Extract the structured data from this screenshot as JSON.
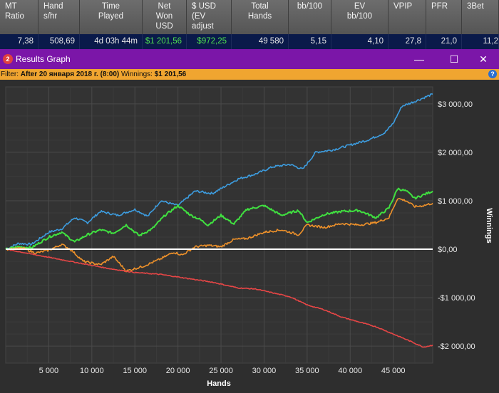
{
  "stats": {
    "headers": [
      [
        "MT",
        "Ratio"
      ],
      [
        "Hand",
        "s/hr"
      ],
      [
        "Time",
        "Played"
      ],
      [
        "Net",
        "Won",
        "USD"
      ],
      [
        "$ USD",
        "(EV",
        "adjust"
      ],
      [
        "Total",
        "Hands"
      ],
      [
        "bb/100"
      ],
      [
        "EV",
        "bb/100"
      ],
      [
        "VPIP"
      ],
      [
        "PFR"
      ],
      [
        "3Bet"
      ]
    ],
    "values": [
      "7,38",
      "508,69",
      "4d 03h 44m",
      "$1 201,56",
      "$972,25",
      "49 580",
      "5,15",
      "4,10",
      "27,8",
      "21,0",
      "11,2"
    ]
  },
  "window": {
    "icon_label": "2",
    "title": "Results Graph",
    "minimize": "—",
    "maximize": "☐",
    "close": "✕"
  },
  "filter": {
    "prefix": "Filter: ",
    "date": "After 20 января 2018 г. (8:00)",
    "winnings_label": " Winnings: ",
    "winnings_value": "$1 201,56",
    "help": "?"
  },
  "chart_data": {
    "type": "line",
    "title": "",
    "xlabel": "Hands",
    "ylabel": "Winnings",
    "xlim": [
      0,
      49580
    ],
    "ylim": [
      -2350,
      3350
    ],
    "x_ticks": [
      5000,
      10000,
      15000,
      20000,
      25000,
      30000,
      35000,
      40000,
      45000
    ],
    "x_tick_labels": [
      "5 000",
      "10 000",
      "15 000",
      "20 000",
      "25 000",
      "30 000",
      "35 000",
      "40 000",
      "45 000"
    ],
    "y_ticks": [
      3000,
      2000,
      1000,
      0,
      -1000,
      -2000
    ],
    "y_tick_labels": [
      "$3 000,00",
      "$2 000,00",
      "$1 000,00",
      "$0,00",
      "-$1 000,00",
      "-$2 000,00"
    ],
    "grid": true,
    "series": [
      {
        "color": "#3d9de0",
        "x": [
          0,
          1500,
          3000,
          5000,
          6500,
          8000,
          9500,
          11000,
          13000,
          15000,
          16500,
          18000,
          20000,
          22000,
          24000,
          25500,
          27000,
          29000,
          31000,
          33000,
          34500,
          36000,
          38000,
          40000,
          42000,
          44000,
          45000,
          46000,
          47500,
          49580
        ],
        "y": [
          0,
          120,
          100,
          350,
          420,
          650,
          550,
          780,
          700,
          820,
          680,
          1000,
          900,
          1200,
          1150,
          1300,
          1450,
          1550,
          1700,
          1750,
          1650,
          2000,
          2050,
          2150,
          2250,
          2400,
          2600,
          2950,
          3050,
          3200
        ]
      },
      {
        "color": "#40e040",
        "x": [
          0,
          1500,
          3000,
          5000,
          6500,
          8000,
          9500,
          11000,
          12500,
          14000,
          15500,
          17000,
          18500,
          20000,
          21500,
          22500,
          23500,
          25000,
          26500,
          28000,
          30000,
          32000,
          34000,
          35000,
          37000,
          39000,
          41000,
          43000,
          44500,
          45500,
          46500,
          47500,
          49580
        ],
        "y": [
          0,
          50,
          30,
          250,
          350,
          150,
          300,
          400,
          330,
          500,
          280,
          420,
          700,
          900,
          700,
          620,
          500,
          700,
          520,
          820,
          900,
          700,
          800,
          550,
          720,
          780,
          800,
          650,
          850,
          1250,
          1200,
          1050,
          1200
        ]
      },
      {
        "color": "#f0922a",
        "x": [
          0,
          2000,
          3500,
          5000,
          6500,
          7500,
          9000,
          11000,
          12500,
          14000,
          16000,
          18000,
          19500,
          20500,
          22000,
          23500,
          25000,
          26500,
          28000,
          30000,
          32000,
          34000,
          35000,
          37000,
          39000,
          41000,
          43000,
          44500,
          45500,
          46500,
          47500,
          48500,
          49580
        ],
        "y": [
          0,
          20,
          -80,
          -20,
          100,
          0,
          -250,
          -320,
          -150,
          -450,
          -350,
          -200,
          -60,
          -120,
          50,
          80,
          50,
          200,
          220,
          350,
          400,
          300,
          500,
          450,
          530,
          500,
          550,
          650,
          1050,
          1000,
          880,
          900,
          950
        ]
      },
      {
        "color": "#e84646",
        "x": [
          0,
          3000,
          6000,
          9000,
          12000,
          15000,
          18000,
          21000,
          24000,
          27000,
          29000,
          31000,
          33000,
          35000,
          37000,
          39000,
          41000,
          43000,
          45000,
          47000,
          48500,
          49580
        ],
        "y": [
          0,
          -100,
          -200,
          -300,
          -400,
          -480,
          -520,
          -600,
          -680,
          -800,
          -820,
          -900,
          -980,
          -1150,
          -1250,
          -1400,
          -1500,
          -1600,
          -1750,
          -1900,
          -2020,
          -1980
        ]
      }
    ]
  }
}
